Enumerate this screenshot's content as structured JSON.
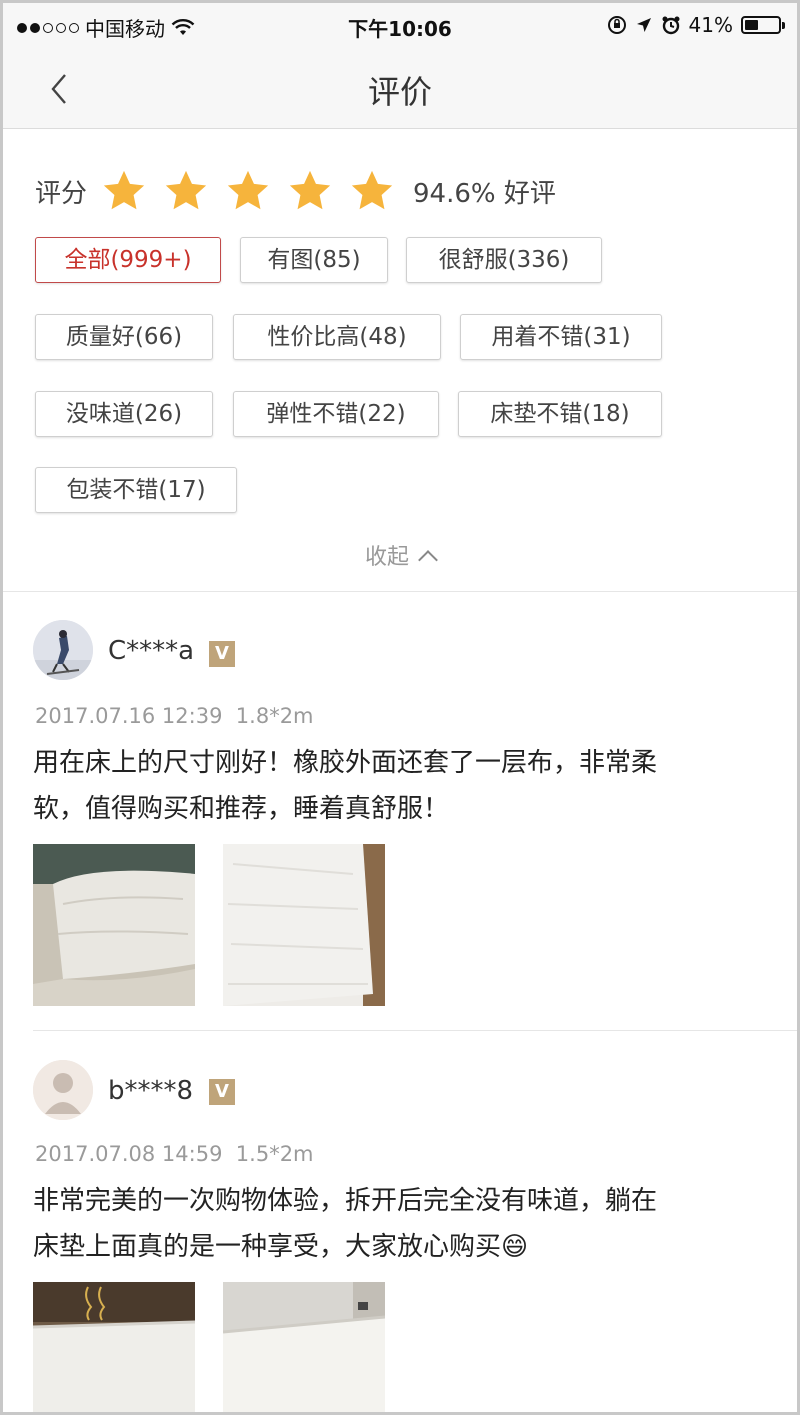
{
  "status_bar": {
    "carrier": "中国移动",
    "time": "下午10:06",
    "battery": "41%",
    "battery_level": 0.41
  },
  "nav": {
    "title": "评价"
  },
  "rating": {
    "label": "评分",
    "stars": 5,
    "summary": "94.6% 好评",
    "star_color": "#f6b43c"
  },
  "tags": [
    {
      "label": "全部(999+)",
      "active": true
    },
    {
      "label": "有图(85)"
    },
    {
      "label": "很舒服(336)"
    },
    {
      "label": "质量好(66)"
    },
    {
      "label": "性价比高(48)"
    },
    {
      "label": "用着不错(31)"
    },
    {
      "label": "没味道(26)"
    },
    {
      "label": "弹性不错(22)"
    },
    {
      "label": "床垫不错(18)"
    },
    {
      "label": "包装不错(17)"
    }
  ],
  "collapse_label": "收起",
  "reviews": [
    {
      "user": "C****a",
      "badge": "V",
      "date": "2017.07.16 12:39",
      "spec": "1.8*2m",
      "text_lines": [
        "用在床上的尺寸刚好！橡胶外面还套了一层布，非常柔",
        "软，值得购买和推荐，睡着真舒服！"
      ]
    },
    {
      "user": "b****8",
      "badge": "V",
      "date": "2017.07.08 14:59",
      "spec": "1.5*2m",
      "text_lines": [
        "非常完美的一次购物体验，拆开后完全没有味道，躺在",
        "床垫上面真的是一种享受，大家放心购买😄"
      ]
    }
  ],
  "colors": {
    "accent_red": "#c8322b",
    "badge_gold": "#bfa47a"
  }
}
